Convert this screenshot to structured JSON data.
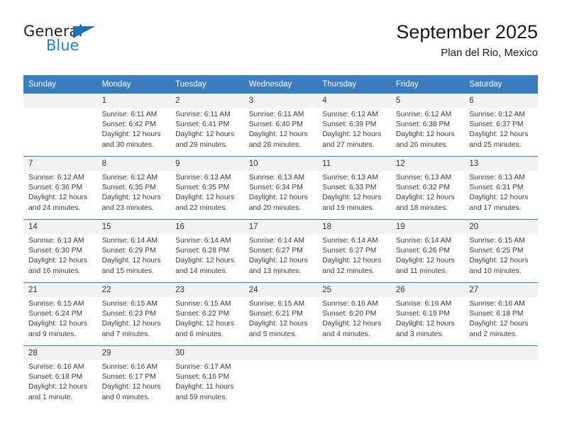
{
  "logo": {
    "primary_text": "General",
    "secondary_text": "Blue",
    "triangle_color": "#1f6fb5",
    "secondary_color": "#1f7fd0"
  },
  "header": {
    "title": "September 2025",
    "subtitle": "Plan del Rio, Mexico"
  },
  "theme": {
    "header_bg": "#3a7dbf",
    "header_text": "#ffffff",
    "daynum_bg": "#f2f2f2",
    "cell_bg": "#ffffff",
    "rule_color": "#3a7dbf"
  },
  "calendar": {
    "columns": [
      "Sunday",
      "Monday",
      "Tuesday",
      "Wednesday",
      "Thursday",
      "Friday",
      "Saturday"
    ],
    "weeks": [
      [
        {
          "day": "",
          "blank": true,
          "sunrise": "",
          "sunset": "",
          "daylight_1": "",
          "daylight_2": ""
        },
        {
          "day": "1",
          "sunrise": "Sunrise: 6:11 AM",
          "sunset": "Sunset: 6:42 PM",
          "daylight_1": "Daylight: 12 hours",
          "daylight_2": "and 30 minutes."
        },
        {
          "day": "2",
          "sunrise": "Sunrise: 6:11 AM",
          "sunset": "Sunset: 6:41 PM",
          "daylight_1": "Daylight: 12 hours",
          "daylight_2": "and 29 minutes."
        },
        {
          "day": "3",
          "sunrise": "Sunrise: 6:11 AM",
          "sunset": "Sunset: 6:40 PM",
          "daylight_1": "Daylight: 12 hours",
          "daylight_2": "and 28 minutes."
        },
        {
          "day": "4",
          "sunrise": "Sunrise: 6:12 AM",
          "sunset": "Sunset: 6:39 PM",
          "daylight_1": "Daylight: 12 hours",
          "daylight_2": "and 27 minutes."
        },
        {
          "day": "5",
          "sunrise": "Sunrise: 6:12 AM",
          "sunset": "Sunset: 6:38 PM",
          "daylight_1": "Daylight: 12 hours",
          "daylight_2": "and 26 minutes."
        },
        {
          "day": "6",
          "sunrise": "Sunrise: 6:12 AM",
          "sunset": "Sunset: 6:37 PM",
          "daylight_1": "Daylight: 12 hours",
          "daylight_2": "and 25 minutes."
        }
      ],
      [
        {
          "day": "7",
          "sunrise": "Sunrise: 6:12 AM",
          "sunset": "Sunset: 6:36 PM",
          "daylight_1": "Daylight: 12 hours",
          "daylight_2": "and 24 minutes."
        },
        {
          "day": "8",
          "sunrise": "Sunrise: 6:12 AM",
          "sunset": "Sunset: 6:35 PM",
          "daylight_1": "Daylight: 12 hours",
          "daylight_2": "and 23 minutes."
        },
        {
          "day": "9",
          "sunrise": "Sunrise: 6:13 AM",
          "sunset": "Sunset: 6:35 PM",
          "daylight_1": "Daylight: 12 hours",
          "daylight_2": "and 22 minutes."
        },
        {
          "day": "10",
          "sunrise": "Sunrise: 6:13 AM",
          "sunset": "Sunset: 6:34 PM",
          "daylight_1": "Daylight: 12 hours",
          "daylight_2": "and 20 minutes."
        },
        {
          "day": "11",
          "sunrise": "Sunrise: 6:13 AM",
          "sunset": "Sunset: 6:33 PM",
          "daylight_1": "Daylight: 12 hours",
          "daylight_2": "and 19 minutes."
        },
        {
          "day": "12",
          "sunrise": "Sunrise: 6:13 AM",
          "sunset": "Sunset: 6:32 PM",
          "daylight_1": "Daylight: 12 hours",
          "daylight_2": "and 18 minutes."
        },
        {
          "day": "13",
          "sunrise": "Sunrise: 6:13 AM",
          "sunset": "Sunset: 6:31 PM",
          "daylight_1": "Daylight: 12 hours",
          "daylight_2": "and 17 minutes."
        }
      ],
      [
        {
          "day": "14",
          "sunrise": "Sunrise: 6:13 AM",
          "sunset": "Sunset: 6:30 PM",
          "daylight_1": "Daylight: 12 hours",
          "daylight_2": "and 16 minutes."
        },
        {
          "day": "15",
          "sunrise": "Sunrise: 6:14 AM",
          "sunset": "Sunset: 6:29 PM",
          "daylight_1": "Daylight: 12 hours",
          "daylight_2": "and 15 minutes."
        },
        {
          "day": "16",
          "sunrise": "Sunrise: 6:14 AM",
          "sunset": "Sunset: 6:28 PM",
          "daylight_1": "Daylight: 12 hours",
          "daylight_2": "and 14 minutes."
        },
        {
          "day": "17",
          "sunrise": "Sunrise: 6:14 AM",
          "sunset": "Sunset: 6:27 PM",
          "daylight_1": "Daylight: 12 hours",
          "daylight_2": "and 13 minutes."
        },
        {
          "day": "18",
          "sunrise": "Sunrise: 6:14 AM",
          "sunset": "Sunset: 6:27 PM",
          "daylight_1": "Daylight: 12 hours",
          "daylight_2": "and 12 minutes."
        },
        {
          "day": "19",
          "sunrise": "Sunrise: 6:14 AM",
          "sunset": "Sunset: 6:26 PM",
          "daylight_1": "Daylight: 12 hours",
          "daylight_2": "and 11 minutes."
        },
        {
          "day": "20",
          "sunrise": "Sunrise: 6:15 AM",
          "sunset": "Sunset: 6:25 PM",
          "daylight_1": "Daylight: 12 hours",
          "daylight_2": "and 10 minutes."
        }
      ],
      [
        {
          "day": "21",
          "sunrise": "Sunrise: 6:15 AM",
          "sunset": "Sunset: 6:24 PM",
          "daylight_1": "Daylight: 12 hours",
          "daylight_2": "and 9 minutes."
        },
        {
          "day": "22",
          "sunrise": "Sunrise: 6:15 AM",
          "sunset": "Sunset: 6:23 PM",
          "daylight_1": "Daylight: 12 hours",
          "daylight_2": "and 7 minutes."
        },
        {
          "day": "23",
          "sunrise": "Sunrise: 6:15 AM",
          "sunset": "Sunset: 6:22 PM",
          "daylight_1": "Daylight: 12 hours",
          "daylight_2": "and 6 minutes."
        },
        {
          "day": "24",
          "sunrise": "Sunrise: 6:15 AM",
          "sunset": "Sunset: 6:21 PM",
          "daylight_1": "Daylight: 12 hours",
          "daylight_2": "and 5 minutes."
        },
        {
          "day": "25",
          "sunrise": "Sunrise: 6:16 AM",
          "sunset": "Sunset: 6:20 PM",
          "daylight_1": "Daylight: 12 hours",
          "daylight_2": "and 4 minutes."
        },
        {
          "day": "26",
          "sunrise": "Sunrise: 6:16 AM",
          "sunset": "Sunset: 6:19 PM",
          "daylight_1": "Daylight: 12 hours",
          "daylight_2": "and 3 minutes."
        },
        {
          "day": "27",
          "sunrise": "Sunrise: 6:16 AM",
          "sunset": "Sunset: 6:18 PM",
          "daylight_1": "Daylight: 12 hours",
          "daylight_2": "and 2 minutes."
        }
      ],
      [
        {
          "day": "28",
          "sunrise": "Sunrise: 6:16 AM",
          "sunset": "Sunset: 6:18 PM",
          "daylight_1": "Daylight: 12 hours",
          "daylight_2": "and 1 minute."
        },
        {
          "day": "29",
          "sunrise": "Sunrise: 6:16 AM",
          "sunset": "Sunset: 6:17 PM",
          "daylight_1": "Daylight: 12 hours",
          "daylight_2": "and 0 minutes."
        },
        {
          "day": "30",
          "sunrise": "Sunrise: 6:17 AM",
          "sunset": "Sunset: 6:16 PM",
          "daylight_1": "Daylight: 11 hours",
          "daylight_2": "and 59 minutes."
        },
        {
          "day": "",
          "blank": true,
          "sunrise": "",
          "sunset": "",
          "daylight_1": "",
          "daylight_2": ""
        },
        {
          "day": "",
          "blank": true,
          "sunrise": "",
          "sunset": "",
          "daylight_1": "",
          "daylight_2": ""
        },
        {
          "day": "",
          "blank": true,
          "sunrise": "",
          "sunset": "",
          "daylight_1": "",
          "daylight_2": ""
        },
        {
          "day": "",
          "blank": true,
          "sunrise": "",
          "sunset": "",
          "daylight_1": "",
          "daylight_2": ""
        }
      ]
    ]
  }
}
